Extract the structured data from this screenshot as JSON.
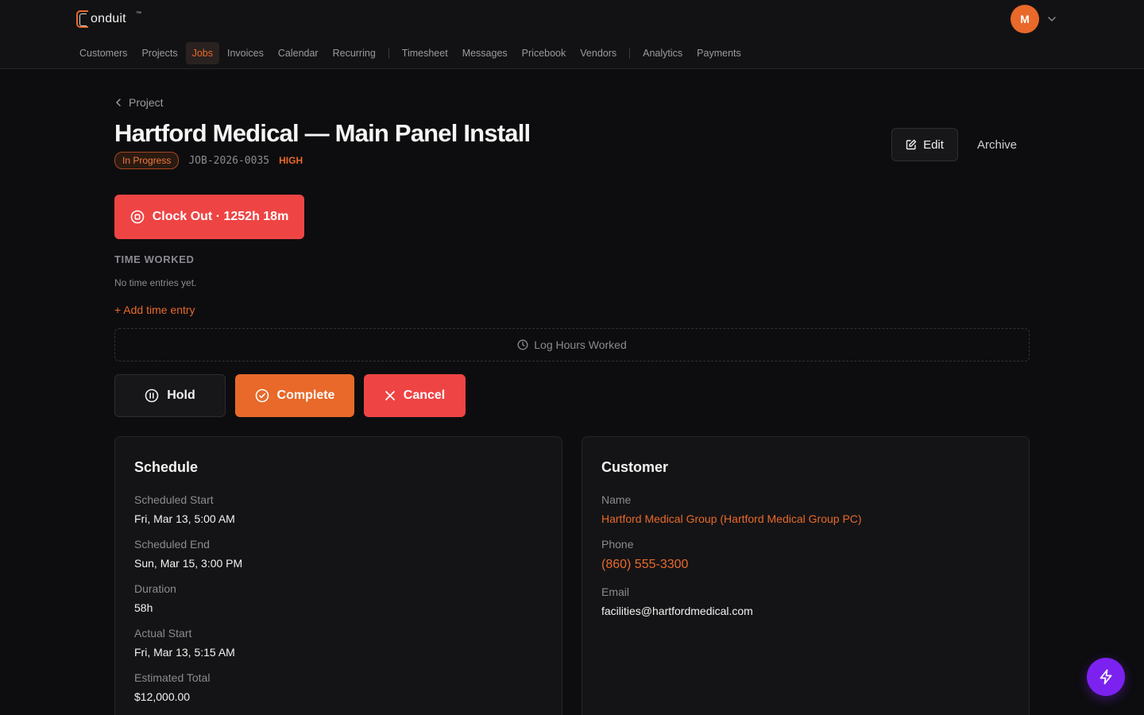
{
  "app": {
    "logo_text": "onduit",
    "logo_tm": "™",
    "avatar_initial": "M"
  },
  "nav": {
    "items": [
      {
        "label": "Customers"
      },
      {
        "label": "Projects"
      },
      {
        "label": "Jobs",
        "active": true
      },
      {
        "label": "Invoices"
      },
      {
        "label": "Calendar"
      },
      {
        "label": "Recurring"
      },
      {
        "label": "Timesheet"
      },
      {
        "label": "Messages"
      },
      {
        "label": "Pricebook"
      },
      {
        "label": "Vendors"
      },
      {
        "label": "Analytics"
      },
      {
        "label": "Payments"
      }
    ]
  },
  "page": {
    "back_label": "Project",
    "title": "Hartford Medical — Main Panel Install",
    "status": "In Progress",
    "job_id": "JOB-2026-0035",
    "priority": "HIGH",
    "edit_label": "Edit",
    "archive_label": "Archive"
  },
  "time": {
    "clock_out_label": "Clock Out · 1252h 18m",
    "heading": "TIME WORKED",
    "empty_text": "No time entries yet.",
    "add_entry_label": "+ Add time entry",
    "log_hours_label": "Log Hours Worked"
  },
  "actions": {
    "hold": "Hold",
    "complete": "Complete",
    "cancel": "Cancel"
  },
  "schedule": {
    "title": "Schedule",
    "fields": [
      {
        "label": "Scheduled Start",
        "value": "Fri, Mar 13, 5:00 AM"
      },
      {
        "label": "Scheduled End",
        "value": "Sun, Mar 15, 3:00 PM"
      },
      {
        "label": "Duration",
        "value": "58h"
      },
      {
        "label": "Actual Start",
        "value": "Fri, Mar 13, 5:15 AM"
      },
      {
        "label": "Estimated Total",
        "value": "$12,000.00"
      }
    ]
  },
  "customer": {
    "title": "Customer",
    "name_label": "Name",
    "name": "Hartford Medical Group (Hartford Medical Group PC)",
    "phone_label": "Phone",
    "phone": "(860) 555-3300",
    "email_label": "Email",
    "email": "facilities@hartfordmedical.com"
  },
  "colors": {
    "accent": "#e8692a",
    "danger": "#ef4444",
    "fab": "#7c22f0",
    "background": "#0d0d0f"
  },
  "icons": {
    "fab": "lightning-icon",
    "edit": "edit-icon",
    "clock_out": "stop-circle-icon",
    "log_hours": "clock-icon",
    "hold": "pause-circle-icon",
    "complete": "check-circle-icon",
    "cancel": "x-icon"
  }
}
